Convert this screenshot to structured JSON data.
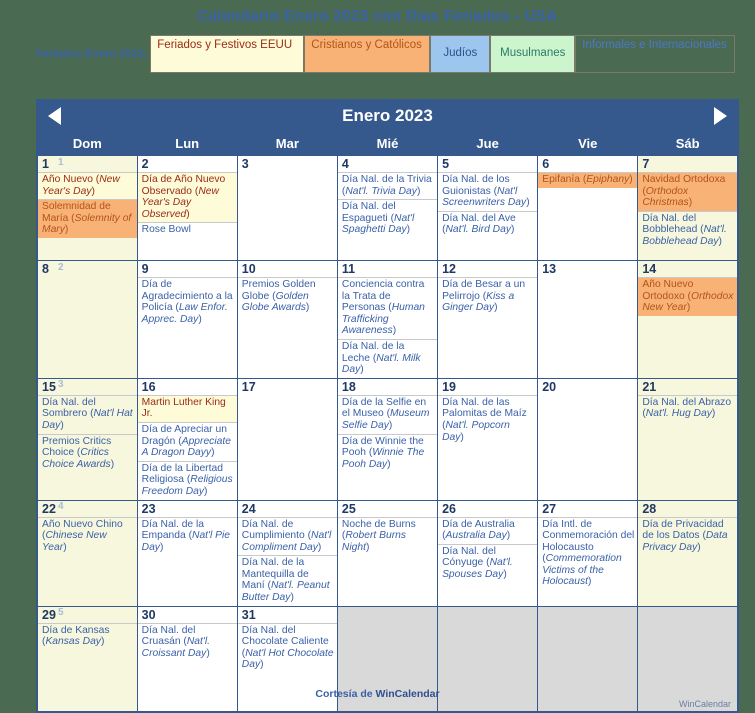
{
  "page": {
    "title": "Calendario Enero 2023 con Dias Feriados - USA",
    "footer_prefix": "Cortesía de ",
    "footer_brand": "WinCalendar",
    "watermark": "WinCalendar",
    "background_color": "#4a6b52",
    "accent_color": "#35598c",
    "title_color": "#3a61a8"
  },
  "legend": {
    "label": "Feriados Enero 2023:",
    "items": [
      {
        "label": "Feriados y Festivos EEUU",
        "bg": "#fdfbd8",
        "fg": "#9c2b15",
        "key": "us"
      },
      {
        "label": "Cristianos y Católicos",
        "bg": "#f8b276",
        "fg": "#b4531a",
        "key": "christian"
      },
      {
        "label": "Judíos",
        "bg": "#9dc6ef",
        "fg": "#2f4f8f",
        "key": "jewish"
      },
      {
        "label": "Musulmanes",
        "bg": "#ccf5cd",
        "fg": "#2b7a6a",
        "key": "muslim"
      },
      {
        "label": "Informales e Internacionales",
        "bg": "transparent",
        "fg": "#4a78c4",
        "key": "international"
      }
    ]
  },
  "calendar": {
    "month_title": "Enero 2023",
    "prev_label": "◀",
    "next_label": "▶",
    "weekday_headers": [
      "Dom",
      "Lun",
      "Mar",
      "Mié",
      "Jue",
      "Vie",
      "Sáb"
    ],
    "week_numbers": [
      "1",
      "2",
      "3",
      "4",
      "5"
    ],
    "weeks": [
      [
        {
          "day": "1",
          "weekend": true,
          "events": [
            {
              "type": "us",
              "text": "Año Nuevo (",
              "em": "New Year's Day",
              "tail": ")"
            },
            {
              "type": "christ",
              "text": "Solemnidad de María (",
              "em": "Solemnity of Mary",
              "tail": ")"
            }
          ]
        },
        {
          "day": "2",
          "weekend": false,
          "events": [
            {
              "type": "us",
              "text": "Día de Año Nuevo Observado (",
              "em": "New Year's Day Observed",
              "tail": ")"
            },
            {
              "type": "intl",
              "text": "Rose Bowl",
              "em": "",
              "tail": ""
            }
          ]
        },
        {
          "day": "3",
          "weekend": false,
          "events": []
        },
        {
          "day": "4",
          "weekend": false,
          "events": [
            {
              "type": "intl",
              "text": "Día Nal. de la Trivia (",
              "em": "Nat'l. Trivia Day",
              "tail": ")"
            },
            {
              "type": "intl",
              "text": "Día Nal. del Espagueti (",
              "em": "Nat'l Spaghetti Day",
              "tail": ")"
            }
          ]
        },
        {
          "day": "5",
          "weekend": false,
          "events": [
            {
              "type": "intl",
              "text": "Día Nal. de los Guionistas (",
              "em": "Nat'l Screenwriters Day",
              "tail": ")"
            },
            {
              "type": "intl",
              "text": "Día Nal. del Ave (",
              "em": "Nat'l. Bird Day",
              "tail": ")"
            }
          ]
        },
        {
          "day": "6",
          "weekend": false,
          "events": [
            {
              "type": "christ",
              "text": "Epifanía (",
              "em": "Epiphany",
              "tail": ")"
            }
          ]
        },
        {
          "day": "7",
          "weekend": true,
          "events": [
            {
              "type": "christ",
              "text": "Navidad Ortodoxa (",
              "em": "Orthodox Christmas",
              "tail": ")"
            },
            {
              "type": "intl",
              "text": "Día Nal. del Bobblehead (",
              "em": "Nat'l. Bobblehead Day",
              "tail": ")"
            }
          ]
        }
      ],
      [
        {
          "day": "8",
          "weekend": true,
          "events": []
        },
        {
          "day": "9",
          "weekend": false,
          "events": [
            {
              "type": "intl",
              "text": "Día de Agradecimiento a la Policía (",
              "em": "Law Enfor. Apprec. Day",
              "tail": ")"
            }
          ]
        },
        {
          "day": "10",
          "weekend": false,
          "events": [
            {
              "type": "intl",
              "text": "Premios Golden Globe (",
              "em": "Golden Globe Awards",
              "tail": ")"
            }
          ]
        },
        {
          "day": "11",
          "weekend": false,
          "events": [
            {
              "type": "intl",
              "text": "Conciencia contra la Trata de Personas (",
              "em": "Human Trafficking Awareness",
              "tail": ")"
            },
            {
              "type": "intl",
              "text": "Día Nal. de la Leche (",
              "em": "Nat'l. Milk Day",
              "tail": ")"
            }
          ]
        },
        {
          "day": "12",
          "weekend": false,
          "events": [
            {
              "type": "intl",
              "text": "Día de Besar a un Pelirrojo (",
              "em": "Kiss a Ginger Day",
              "tail": ")"
            }
          ]
        },
        {
          "day": "13",
          "weekend": false,
          "events": []
        },
        {
          "day": "14",
          "weekend": true,
          "events": [
            {
              "type": "christ",
              "text": "Año Nuevo Ortodoxo (",
              "em": "Orthodox New Year",
              "tail": ")"
            }
          ]
        }
      ],
      [
        {
          "day": "15",
          "weekend": true,
          "events": [
            {
              "type": "intl",
              "text": "Día Nal. del Sombrero (",
              "em": "Nat'l Hat Day",
              "tail": ")"
            },
            {
              "type": "intl",
              "text": "Premios Critics Choice (",
              "em": "Critics Choice Awards",
              "tail": ")"
            }
          ]
        },
        {
          "day": "16",
          "weekend": false,
          "events": [
            {
              "type": "us",
              "text": "Martin Luther King Jr.",
              "em": "",
              "tail": ""
            },
            {
              "type": "intl",
              "text": "Día de Apreciar un Dragón (",
              "em": "Appreciate A Dragon Dayy",
              "tail": ")"
            },
            {
              "type": "intl",
              "text": "Día de la Libertad Religiosa (",
              "em": "Religious Freedom Day",
              "tail": ")"
            }
          ]
        },
        {
          "day": "17",
          "weekend": false,
          "events": []
        },
        {
          "day": "18",
          "weekend": false,
          "events": [
            {
              "type": "intl",
              "text": "Día de la Selfie en el Museo (",
              "em": "Museum Selfie Day",
              "tail": ")"
            },
            {
              "type": "intl",
              "text": "Día de Winnie the Pooh (",
              "em": "Winnie The Pooh Day",
              "tail": ")"
            }
          ]
        },
        {
          "day": "19",
          "weekend": false,
          "events": [
            {
              "type": "intl",
              "text": "Día Nal. de las Palomitas de Maíz (",
              "em": "Nat'l. Popcorn Day",
              "tail": ")"
            }
          ]
        },
        {
          "day": "20",
          "weekend": false,
          "events": []
        },
        {
          "day": "21",
          "weekend": true,
          "events": [
            {
              "type": "intl",
              "text": "Día Nal. del Abrazo (",
              "em": "Nat'l. Hug Day",
              "tail": ")"
            }
          ]
        }
      ],
      [
        {
          "day": "22",
          "weekend": true,
          "events": [
            {
              "type": "intl",
              "text": "Año Nuevo Chino (",
              "em": "Chinese New Year",
              "tail": ")"
            }
          ]
        },
        {
          "day": "23",
          "weekend": false,
          "events": [
            {
              "type": "intl",
              "text": "Día Nal. de la Empanda (",
              "em": "Nat'l Pie Day",
              "tail": ")"
            }
          ]
        },
        {
          "day": "24",
          "weekend": false,
          "events": [
            {
              "type": "intl",
              "text": "Día Nal. de Cumplimiento (",
              "em": "Nat'l Compliment Day",
              "tail": ")"
            },
            {
              "type": "intl",
              "text": "Día Nal. de la Mantequilla de Maní (",
              "em": "Nat'l. Peanut Butter Day",
              "tail": ")"
            }
          ]
        },
        {
          "day": "25",
          "weekend": false,
          "events": [
            {
              "type": "intl",
              "text": "Noche de Burns (",
              "em": "Robert Burns Night",
              "tail": ")"
            }
          ]
        },
        {
          "day": "26",
          "weekend": false,
          "events": [
            {
              "type": "intl",
              "text": "Día de Australia (",
              "em": "Australia Day",
              "tail": ")"
            },
            {
              "type": "intl",
              "text": "Día Nal. del Cónyuge (",
              "em": "Nat'l. Spouses Day",
              "tail": ")"
            }
          ]
        },
        {
          "day": "27",
          "weekend": false,
          "events": [
            {
              "type": "intl",
              "text": "Día Intl. de Conmemoración del Holocausto (",
              "em": "Commemoration Victims of the Holocaust",
              "tail": ")"
            }
          ]
        },
        {
          "day": "28",
          "weekend": true,
          "events": [
            {
              "type": "intl",
              "text": "Día de Privacidad de los Datos (",
              "em": "Data Privacy Day",
              "tail": ")"
            }
          ]
        }
      ],
      [
        {
          "day": "29",
          "weekend": true,
          "events": [
            {
              "type": "intl",
              "text": "Día de Kansas (",
              "em": "Kansas Day",
              "tail": ")"
            }
          ]
        },
        {
          "day": "30",
          "weekend": false,
          "events": [
            {
              "type": "intl",
              "text": "Día Nal. del Cruasán (",
              "em": "Nat'l. Croissant Day",
              "tail": ")"
            }
          ]
        },
        {
          "day": "31",
          "weekend": false,
          "events": [
            {
              "type": "intl",
              "text": "Día Nal. del Chocolate Caliente (",
              "em": "Nat'l Hot Chocolate Day",
              "tail": ")"
            }
          ]
        },
        {
          "day": "",
          "weekend": false,
          "blank": true,
          "events": []
        },
        {
          "day": "",
          "weekend": false,
          "blank": true,
          "events": []
        },
        {
          "day": "",
          "weekend": false,
          "blank": true,
          "events": []
        },
        {
          "day": "",
          "weekend": false,
          "blank": true,
          "events": []
        }
      ]
    ]
  }
}
